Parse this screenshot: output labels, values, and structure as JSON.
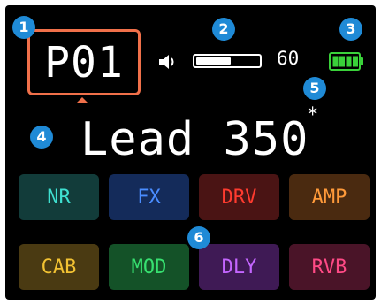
{
  "preset": {
    "number": "P01",
    "name": "Lead 350",
    "modified_marker": "*",
    "frame_color": "#f0704a"
  },
  "volume": {
    "level": 0.55,
    "value": "60",
    "icon": "speaker-icon"
  },
  "battery": {
    "icon": "battery-icon",
    "segments_lit": 4,
    "segments_total": 4,
    "color": "#3ad13a"
  },
  "effect_blocks": [
    {
      "id": "nr",
      "label": "NR",
      "bg": "#123c3a",
      "fg": "#3fe0d0"
    },
    {
      "id": "fx",
      "label": "FX",
      "bg": "#142b5a",
      "fg": "#4a8dff"
    },
    {
      "id": "drv",
      "label": "DRV",
      "bg": "#4a1414",
      "fg": "#ff3b2f"
    },
    {
      "id": "amp",
      "label": "AMP",
      "bg": "#4a2a10",
      "fg": "#ff9a3a"
    },
    {
      "id": "cab",
      "label": "CAB",
      "bg": "#4a3a12",
      "fg": "#f2c233"
    },
    {
      "id": "mod",
      "label": "MOD",
      "bg": "#145228",
      "fg": "#37e070"
    },
    {
      "id": "dly",
      "label": "DLY",
      "bg": "#3f1a55",
      "fg": "#c466ff"
    },
    {
      "id": "rvb",
      "label": "RVB",
      "bg": "#4a1428",
      "fg": "#ff4a86"
    }
  ],
  "callouts": [
    "1",
    "2",
    "3",
    "4",
    "5",
    "6"
  ],
  "colors": {
    "screen": "#000000",
    "callout": "#1f8ad6"
  }
}
